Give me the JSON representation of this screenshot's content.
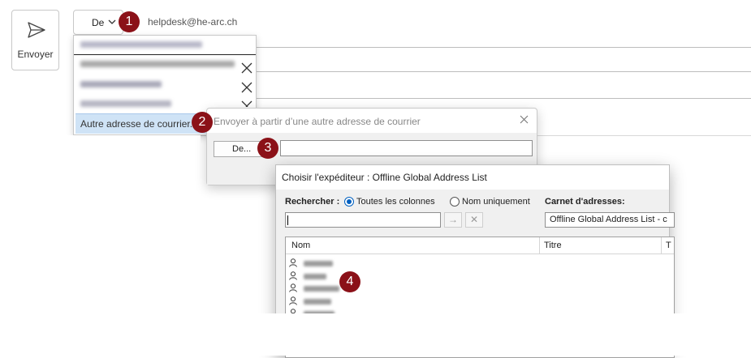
{
  "toolbar": {
    "send_label": "Envoyer"
  },
  "from": {
    "button_label": "De",
    "value": "helpdesk@he-arc.ch"
  },
  "dropdown": {
    "other_address_label": "Autre adresse de courrier..."
  },
  "badges": [
    "1",
    "2",
    "3",
    "4"
  ],
  "dialog_other_address": {
    "title": "Envoyer à partir d’une autre adresse de courrier",
    "from_button": "De...",
    "input_value": ""
  },
  "dialog_choose_sender": {
    "title": "Choisir l'expéditeur : Offline Global Address List",
    "search_label": "Rechercher :",
    "radio_all": "Toutes les colonnes",
    "radio_name_only": "Nom uniquement",
    "address_book_label": "Carnet d'adresses:",
    "address_book_value": "Offline Global Address List - c",
    "go_icon": "→",
    "clear_icon": "✕",
    "columns": [
      "Nom",
      "Titre",
      "T"
    ]
  },
  "colors": {
    "badge": "#8b1118",
    "selection": "#cfe3f6",
    "radio_accent": "#0060c0"
  },
  "icons": [
    "send-icon",
    "chevron-down-icon",
    "close-icon",
    "person-icon",
    "arrow-right-icon"
  ]
}
